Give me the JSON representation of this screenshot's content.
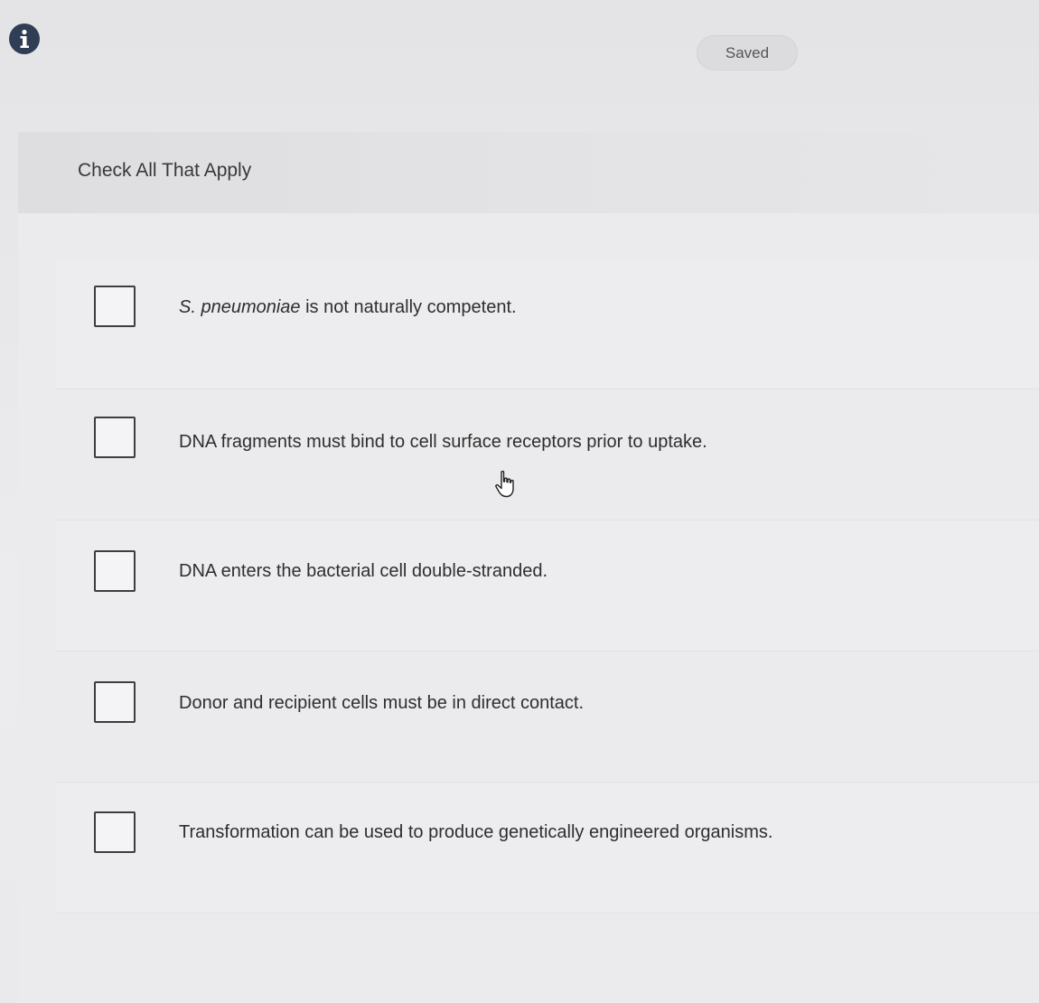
{
  "header": {
    "info_icon": "info-icon",
    "save_status": "Saved"
  },
  "question": {
    "instruction": "Check All That Apply",
    "options": [
      {
        "italic_prefix": "S. pneumoniae",
        "text": " is not naturally competent.",
        "checked": false
      },
      {
        "italic_prefix": "",
        "text": "DNA fragments must bind to cell surface receptors prior to uptake.",
        "checked": false
      },
      {
        "italic_prefix": "",
        "text": "DNA enters the bacterial cell double-stranded.",
        "checked": false
      },
      {
        "italic_prefix": "",
        "text": "Donor and recipient cells must be in direct contact.",
        "checked": false
      },
      {
        "italic_prefix": "",
        "text": "Transformation can be used to produce genetically engineered organisms.",
        "checked": false
      }
    ]
  },
  "cursor": "hand-pointer-icon"
}
